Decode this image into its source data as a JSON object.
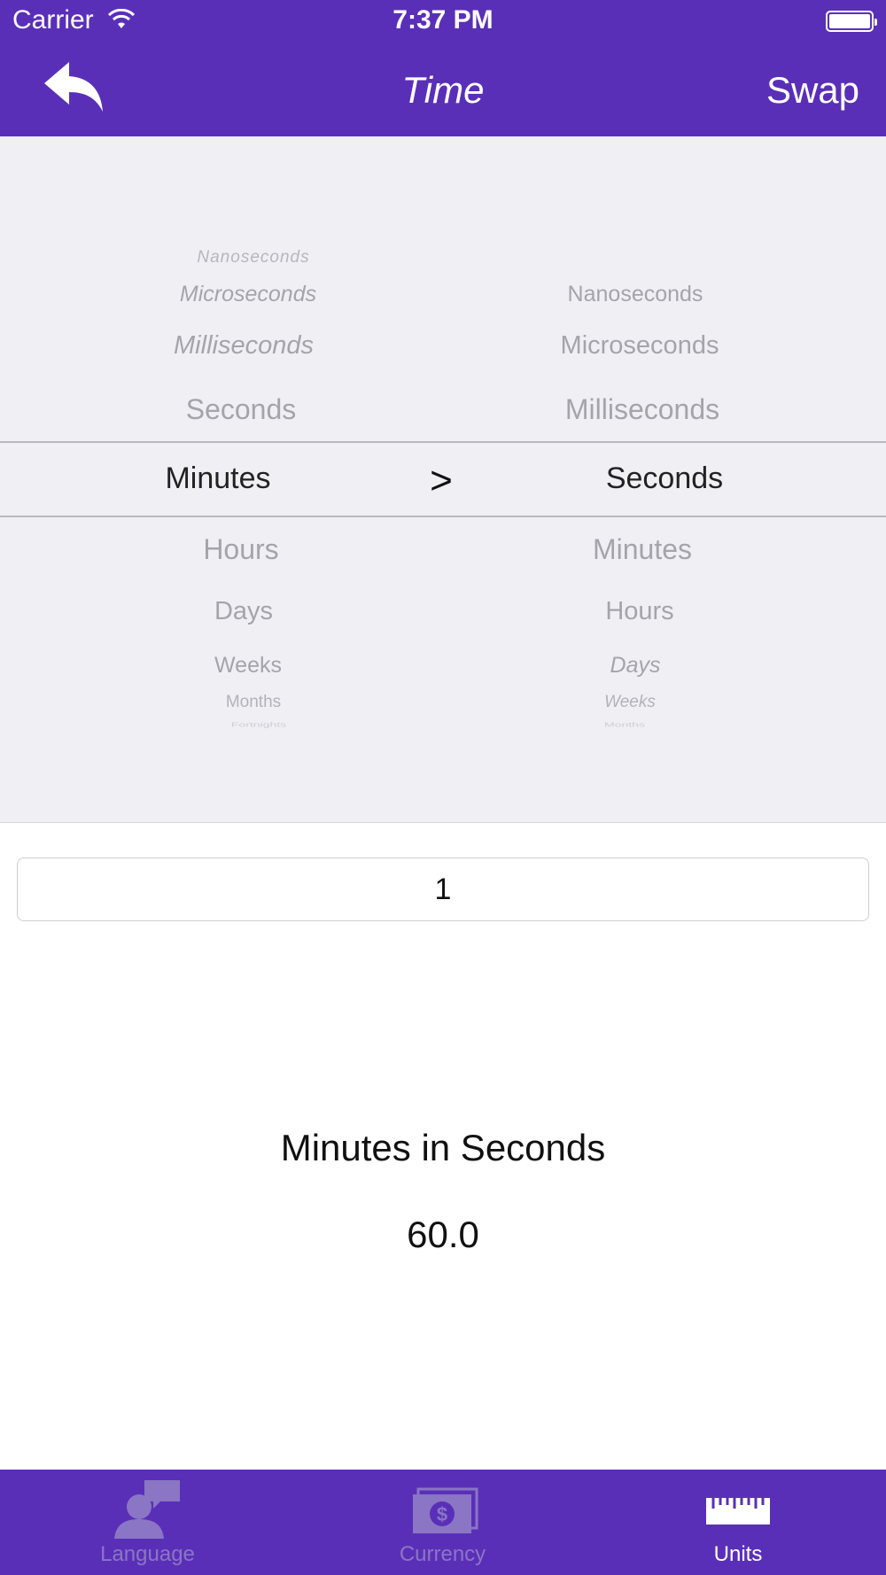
{
  "status_bar": {
    "carrier": "Carrier",
    "time": "7:37 PM"
  },
  "nav": {
    "title": "Time",
    "swap_label": "Swap",
    "back_icon": "reply-arrow-icon"
  },
  "picker": {
    "left_column": [
      "Nanoseconds",
      "Microseconds",
      "Milliseconds",
      "Seconds",
      "Minutes",
      "Hours",
      "Days",
      "Weeks",
      "Months",
      "Fortnights"
    ],
    "right_column": [
      "Nanoseconds",
      "Microseconds",
      "Milliseconds",
      "Seconds",
      "Minutes",
      "Hours",
      "Days",
      "Weeks",
      "Months"
    ],
    "left_selected": "Minutes",
    "right_selected": "Seconds",
    "separator": ">"
  },
  "input": {
    "value": "1"
  },
  "result": {
    "label": "Minutes in Seconds",
    "value": "60.0"
  },
  "tabs": [
    {
      "label": "Language",
      "icon": "person-speech-icon",
      "active": false
    },
    {
      "label": "Currency",
      "icon": "money-stack-icon",
      "active": false
    },
    {
      "label": "Units",
      "icon": "ruler-icon",
      "active": true
    }
  ],
  "colors": {
    "accent": "#5a2fb8",
    "picker_bg": "#efeff4",
    "inactive_tab": "#8a76c4"
  }
}
